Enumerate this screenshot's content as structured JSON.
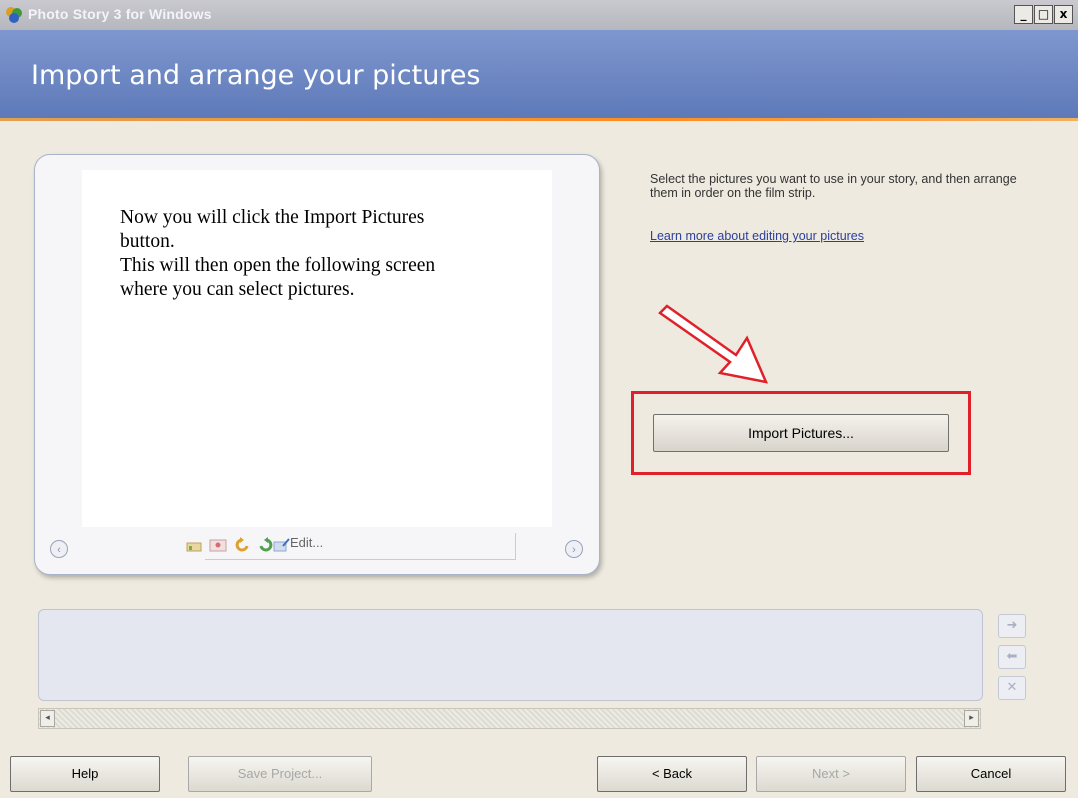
{
  "window": {
    "title": "Photo Story 3 for Windows",
    "minimize": "_",
    "maximize": "□",
    "close": "x"
  },
  "header": {
    "title": "Import and arrange your pictures"
  },
  "preview": {
    "annotation_lines": [
      "Now you will click the Import Pictures button.",
      "This will then open the following screen where you can select pictures."
    ],
    "prev_glyph": "‹",
    "next_glyph": "›",
    "edit_label": "Edit..."
  },
  "instructions": {
    "text": "Select the pictures you want to use in your story, and then arrange them in order on the film strip.",
    "link": "Learn more about editing your pictures"
  },
  "import_button": "Import Pictures...",
  "filmstrip_buttons": {
    "move_right": "➜",
    "move_left": "⬅",
    "remove": "✕"
  },
  "scrollbar": {
    "left": "◂",
    "right": "▸"
  },
  "footer": {
    "help": "Help",
    "save": "Save Project...",
    "back": "< Back",
    "next": "Next >",
    "cancel": "Cancel"
  },
  "colors": {
    "header": "#6a84c2",
    "highlight": "#e0202a",
    "link": "#2b3f9c"
  }
}
